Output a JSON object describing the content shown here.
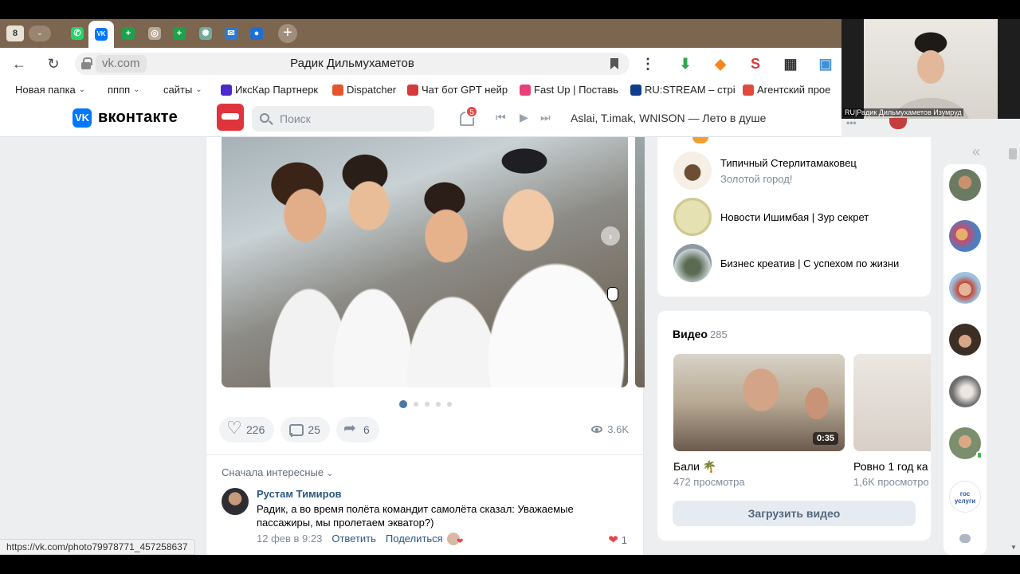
{
  "browser": {
    "tab_count": "8",
    "tabs": [
      {
        "icon": "whatsapp-icon",
        "color": "#25d366",
        "glyph": "✆"
      },
      {
        "icon": "vk-icon",
        "color": "#0077ff",
        "glyph": "VK",
        "active": true
      },
      {
        "icon": "plus-green-icon",
        "color": "#1aa34a",
        "glyph": "+"
      },
      {
        "icon": "circle-app-icon",
        "color": "#b8a996",
        "glyph": "◎"
      },
      {
        "icon": "plus-green-icon",
        "color": "#1aa34a",
        "glyph": "+"
      },
      {
        "icon": "chatgpt-icon",
        "color": "#74aa9c",
        "glyph": "✺"
      },
      {
        "icon": "mail-icon",
        "color": "#2a7ad4",
        "glyph": "✉"
      },
      {
        "icon": "chat-bubble-icon",
        "color": "#1d6fd8",
        "glyph": "●"
      }
    ],
    "url_domain": "vk.com",
    "page_title": "Радик Дильмухаметов",
    "extensions": [
      {
        "icon": "download-arrow-icon",
        "color": "#2fa84f",
        "glyph": "⬇"
      },
      {
        "icon": "metamask-icon",
        "color": "#f6851b",
        "glyph": "◆"
      },
      {
        "icon": "s-extension-icon",
        "color": "#d63a3a",
        "glyph": "S"
      },
      {
        "icon": "qr-code-icon",
        "color": "#333333",
        "glyph": "▦"
      },
      {
        "icon": "robot-extension-icon",
        "color": "#3d8fd6",
        "glyph": "▣"
      }
    ],
    "bookmarks": [
      {
        "label": "Новая папка",
        "folder": true
      },
      {
        "label": "пппп",
        "folder": true
      },
      {
        "label": "сайты",
        "folder": true
      },
      {
        "label": "ИксКар Партнерк",
        "color": "#4b2ac9"
      },
      {
        "label": "Dispatcher",
        "color": "#e5542b"
      },
      {
        "label": "Чат бот GPT нейр",
        "color": "#d33a3a"
      },
      {
        "label": "Fast Up | Поставь",
        "color": "#e8417a"
      },
      {
        "label": "RU:STREAM – стрі",
        "color": "#0f3c8c"
      },
      {
        "label": "Агентский прое",
        "color": "#e04a3c"
      }
    ]
  },
  "vk": {
    "logo_text": "вконтакте",
    "search_placeholder": "Поиск",
    "notifications": "5",
    "now_playing": "Aslai, T.imak, WNISON — Лето в душе"
  },
  "post": {
    "likes": "226",
    "comments": "25",
    "shares": "6",
    "views": "3.6K",
    "photo_count": 5,
    "photo_index": 1,
    "sort_label": "Сначала интересные",
    "comment": {
      "author": "Рустам Тимиров",
      "text": "Радик, а во время полёта командит самолёта сказал: Уважаемые пассажиры, мы пролетаем экватор?)",
      "date": "12 фев в 9:23",
      "reply": "Ответить",
      "share": "Поделиться",
      "likes": "1"
    }
  },
  "groups": [
    {
      "name": "Типичный Стерлитамаковец",
      "sub": "Золотой город!"
    },
    {
      "name": "Новости Ишимбая | Зур секрет",
      "sub": ""
    },
    {
      "name": "Бизнес креатив | С успехом по жизни",
      "sub": ""
    }
  ],
  "videos": {
    "title": "Видео",
    "count": "285",
    "items": [
      {
        "name": "Бали 🌴",
        "views": "472 просмотра",
        "duration": "0:35"
      },
      {
        "name": "Ровно 1 год ка",
        "views": "1,6K просмотро",
        "duration": ""
      }
    ],
    "upload_label": "Загрузить видео"
  },
  "friends_rail_count": 6,
  "gos_label": "гос услуги",
  "status_url": "https://vk.com/photo79978771_457258637",
  "webcam_label": "RU|Радик Дильмухаметов Изумруд"
}
